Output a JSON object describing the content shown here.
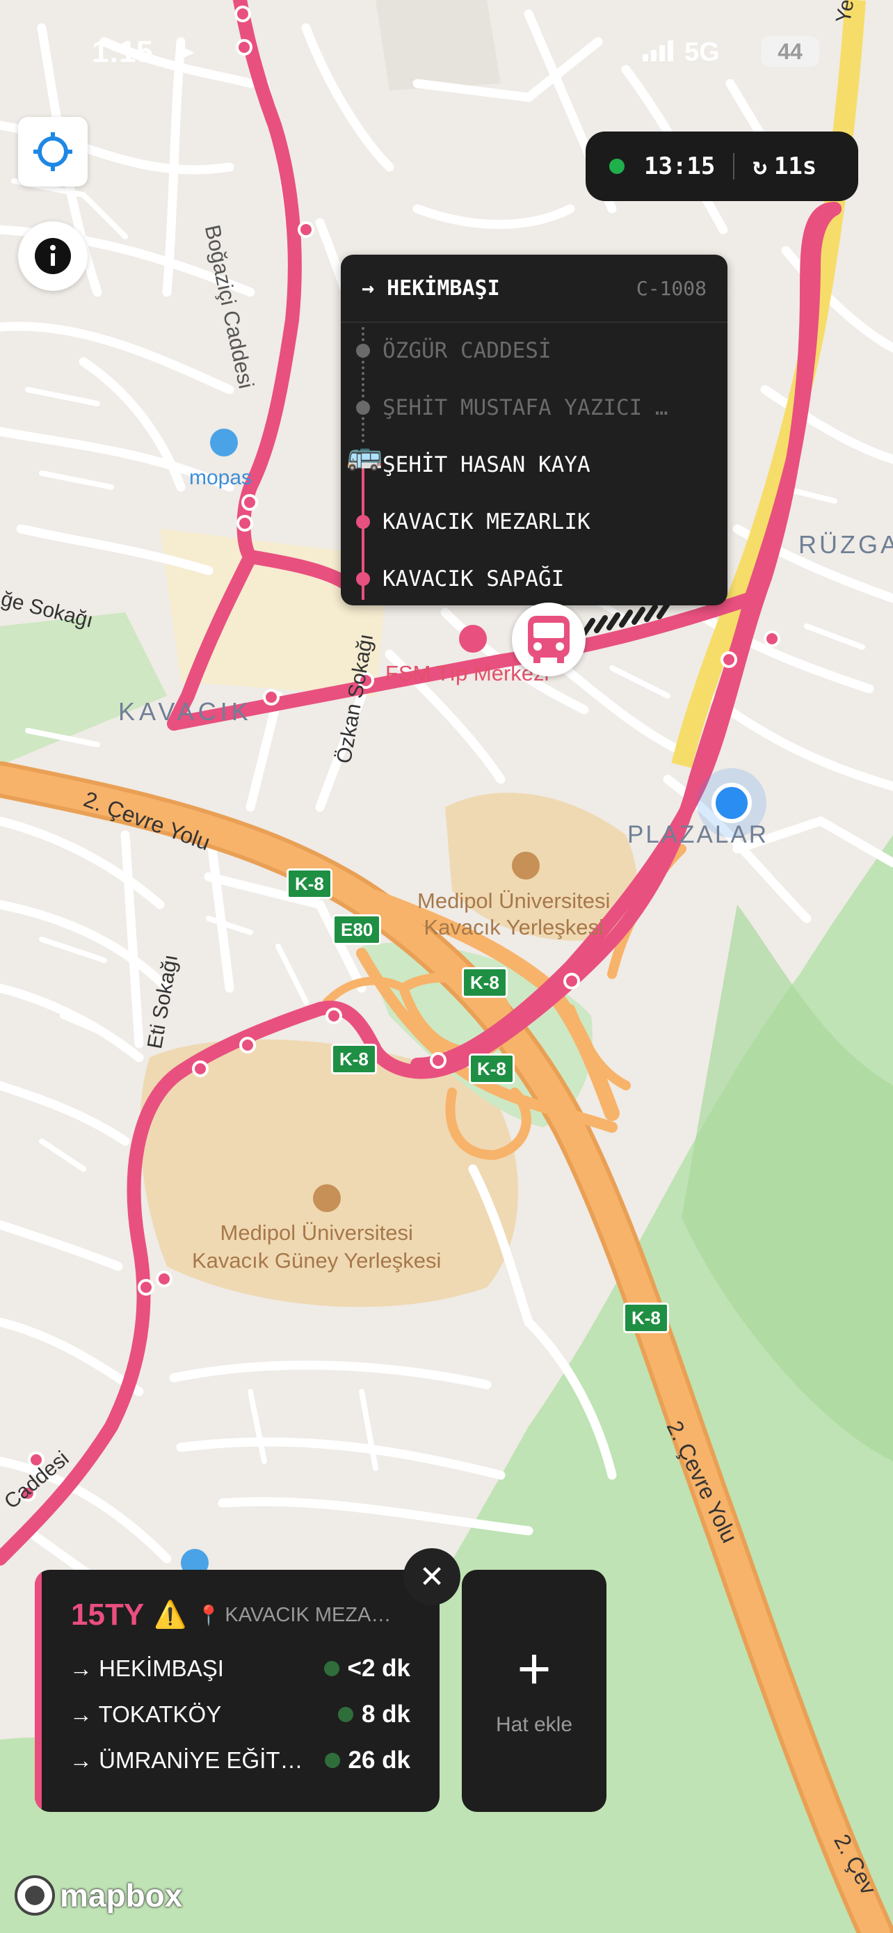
{
  "status_bar": {
    "time": "1:15",
    "network": "5G",
    "battery": "44"
  },
  "top_pill": {
    "time": "13:15",
    "refresh": "11s"
  },
  "popup": {
    "destination": "→ HEKİMBAŞI",
    "code": "C-1008",
    "stops": [
      {
        "label": "ÖZGÜR CADDESİ",
        "state": "past"
      },
      {
        "label": "ŞEHİT MUSTAFA YAZICI …",
        "state": "past"
      },
      {
        "label": "ŞEHİT HASAN KAYA",
        "state": "current"
      },
      {
        "label": "KAVACIK MEZARLIK",
        "state": "next"
      },
      {
        "label": "KAVACIK SAPAĞI",
        "state": "next"
      }
    ]
  },
  "map_labels": {
    "bogazici_caddesi": "Boğaziçi Caddesi",
    "mopas": "mopas",
    "ruzgar": "RÜZGA",
    "sokak_left": "ğe Sokağı",
    "kavacik": "KAVACIK",
    "ozkan_sokagi": "Özkan Sokağı",
    "fsm": "FSM Tıp Merkezi",
    "cevre_yolu_1": "2. Çevre Yolu",
    "plazalar": "PLAZALAR",
    "medipol_kavacik_1": "Medipol Üniversitesi",
    "medipol_kavacik_2": "Kavacık Yerleşkesi",
    "eti_sokagi": "Eti Sokağı",
    "medipol_guney_1": "Medipol Üniversitesi",
    "medipol_guney_2": "Kavacık Güney Yerleşkesi",
    "cevre_yolu_2": "2. Çevre Yolu",
    "cevre_yolu_3": "2. Çev",
    "caddesi_bottom": "Caddesi",
    "top_right": "Ye"
  },
  "shields": {
    "k8": "K-8",
    "e80": "E80"
  },
  "line_card": {
    "line": "15TY",
    "warning_icon": "⚠️",
    "stop": "KAVACIK MEZA…",
    "rows": [
      {
        "direction": "→ HEKİMBAŞI",
        "eta": "<2 dk"
      },
      {
        "direction": "→ TOKATKÖY",
        "eta": "8 dk"
      },
      {
        "direction": "→ ÜMRANİYE EĞİT…",
        "eta": "26 dk"
      }
    ]
  },
  "add_line": {
    "label": "Hat ekle"
  },
  "attribution": "mapbox",
  "colors": {
    "route": "#ea4e7f",
    "highway": "#f5a85a",
    "accent_green": "#20b04b",
    "user_location": "#2a8df2"
  }
}
